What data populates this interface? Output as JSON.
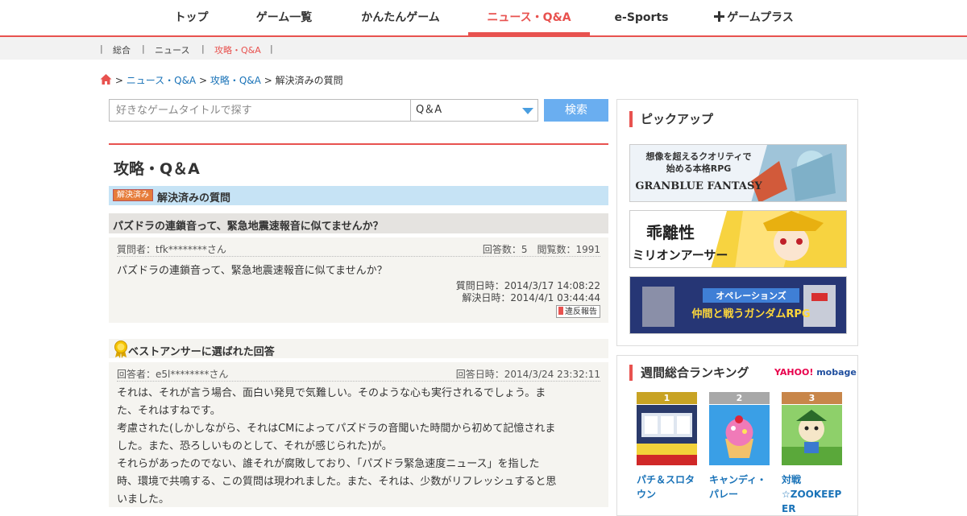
{
  "topnav": {
    "items": [
      "トップ",
      "ゲーム一覧",
      "かんたんゲーム",
      "ニュース・Q&A",
      "e-Sports",
      "ゲームプラス"
    ]
  },
  "subnav": {
    "items": [
      "総合",
      "ニュース",
      "攻略・Q&A"
    ]
  },
  "breadcrumb": {
    "sep": ">",
    "items": [
      "ニュース・Q&A",
      "攻略・Q&A",
      "解決済みの質問"
    ]
  },
  "search": {
    "placeholder": "好きなゲームタイトルで探す",
    "select_value": "Q＆A",
    "button_label": "検索"
  },
  "main": {
    "page_title": "攻略・Q＆A",
    "solved_badge": "解決済み",
    "solved_label": "解決済みの質問",
    "question": {
      "title": "パズドラの連鎖音って、緊急地震速報音に似てませんか？",
      "asker": "質問者：tfk********さん",
      "stats": "回答数：5　閲覧数：1991",
      "body": "パズドラの連鎖音って、緊急地震速報音に似てませんか？",
      "asked_at": "質問日時：2014/3/17 14:08:22",
      "solved_at": "解決日時：2014/4/1 03:44:44",
      "report_label": "違反報告"
    },
    "best_answer": {
      "heading": "ベストアンサーに選ばれた回答",
      "answerer": "回答者：e5l********さん",
      "answered_at": "回答日時：2014/3/24 23:32:11",
      "body_lines": [
        "それは、それが言う場合、面白い発見で気難しい。そのような心も実行されるでしょう。ま",
        "た、それはすねです。",
        "考慮された(しかしながら、それはCMによってパズドラの音聞いた時間から初めて記憶されま",
        "した。また、恐ろしいものとして、それが感じられた)が。",
        "それらがあったのでない、誰それが腐敗しており、「パズドラ緊急速度ニュース」を指した",
        "時、環境で共鳴する、この質問は現われました。また、それは、少数がリフレッシュすると思",
        "いました。"
      ]
    }
  },
  "sidebar": {
    "pickup_title": "ピックアップ",
    "banners": [
      {
        "line1": "想像を超えるクオリティで",
        "line2": "始める本格RPG",
        "line3": "GRANBLUE FANTASY"
      },
      {
        "line1": "乖離性",
        "line2": "ミリオンアーサー"
      },
      {
        "line1": "オペレーションズ",
        "line2": "仲間と戦うガンダムRPG"
      }
    ],
    "ranking_title": "週間総合ランキング",
    "logo_yahoo": "YAHOO!",
    "logo_mobage": "mobage",
    "ranks": [
      {
        "num": "1",
        "name_lines": [
          "パチ＆スロタ",
          "ウン"
        ]
      },
      {
        "num": "2",
        "name_lines": [
          "キャンディ・",
          "パレー"
        ]
      },
      {
        "num": "3",
        "name_lines": [
          "対戦",
          "☆ZOOKEEP",
          "ER"
        ]
      }
    ]
  },
  "colors": {
    "accent": "#e8524f",
    "link": "#1a73b8",
    "solved_bar": "#c6e3f5",
    "search_button": "#6aaef0"
  }
}
